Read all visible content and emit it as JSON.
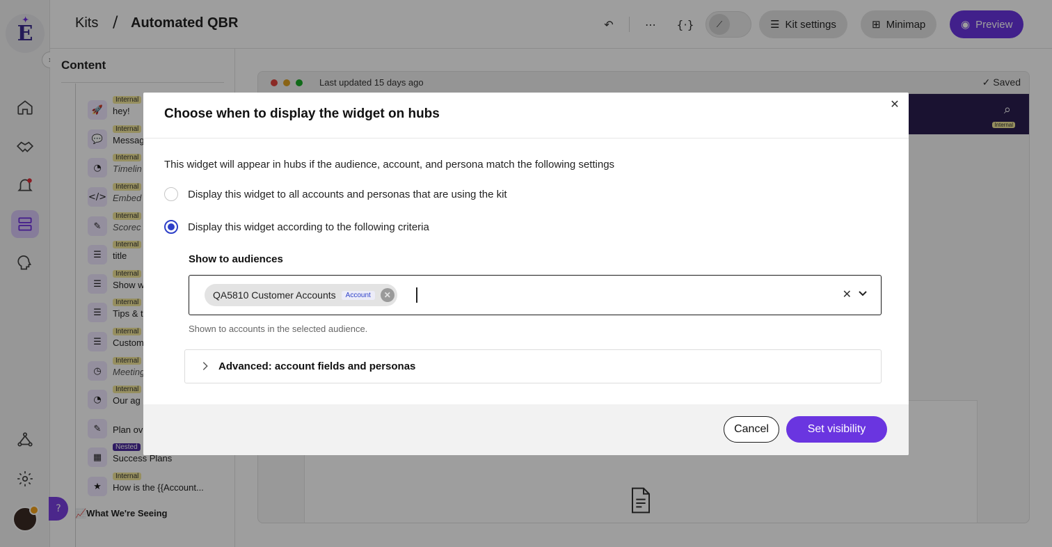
{
  "breadcrumb": {
    "root": "Kits",
    "separator": "/",
    "current": "Automated QBR"
  },
  "toolbar": {
    "kit_settings_label": "Kit settings",
    "minimap_label": "Minimap",
    "preview_label": "Preview"
  },
  "content_panel": {
    "title": "Content",
    "items": [
      {
        "badge": "Internal",
        "label": "hey!",
        "icon": "rocket-icon",
        "italic": false
      },
      {
        "badge": "Internal",
        "label": "Messag",
        "icon": "chat-icon",
        "italic": false
      },
      {
        "badge": "Internal",
        "label": "Timelin",
        "icon": "timeline-icon",
        "italic": true
      },
      {
        "badge": "Internal",
        "label": "Embed",
        "icon": "embed-icon",
        "italic": true
      },
      {
        "badge": "Internal",
        "label": "Scorec",
        "icon": "scorecard-icon",
        "italic": true
      },
      {
        "badge": "Internal",
        "label": "title",
        "icon": "text-block-icon",
        "italic": false
      },
      {
        "badge": "Internal",
        "label": "Show w",
        "icon": "text-block-icon",
        "italic": false
      },
      {
        "badge": "Internal",
        "label": "Tips & t",
        "icon": "text-block-icon",
        "italic": false
      },
      {
        "badge": "Internal",
        "label": "Custom",
        "icon": "text-block-icon",
        "italic": false
      },
      {
        "badge": "Internal",
        "label": "Meeting",
        "icon": "meeting-icon",
        "italic": true
      },
      {
        "badge": "Internal",
        "label": "Our ag",
        "icon": "timeline-icon",
        "italic": false
      },
      {
        "badge": "",
        "label": "Plan ov",
        "icon": "scorecard-icon",
        "italic": false
      },
      {
        "badge": "Nested",
        "label": "Success Plans",
        "icon": "success-plan-icon",
        "italic": false
      },
      {
        "badge": "Internal",
        "label": "How is the {{Account...",
        "icon": "survey-icon",
        "italic": false
      }
    ],
    "section_heading": "📈What We're Seeing"
  },
  "preview": {
    "last_updated": "Last updated 15 days ago",
    "saved": "Saved",
    "internal_tag": "Internal"
  },
  "modal": {
    "title": "Choose when to display the widget on hubs",
    "description": "This widget will appear in hubs if the audience, account, and persona match the following settings",
    "options": [
      {
        "label": "Display this widget to all accounts and personas that are using the kit",
        "checked": false
      },
      {
        "label": "Display this widget according to the following criteria",
        "checked": true
      }
    ],
    "audiences_label": "Show to audiences",
    "selected_audience": {
      "name": "QA5810 Customer Accounts",
      "tag": "Account"
    },
    "helper_text": "Shown to accounts in the selected audience.",
    "advanced_label": "Advanced: account fields and personas",
    "cancel_label": "Cancel",
    "submit_label": "Set visibility"
  },
  "colors": {
    "brand_purple": "#6a35e0",
    "radio_blue": "#2d3fc8",
    "hub_header": "#2b1e4f",
    "internal_badge": "#f3e79a"
  }
}
